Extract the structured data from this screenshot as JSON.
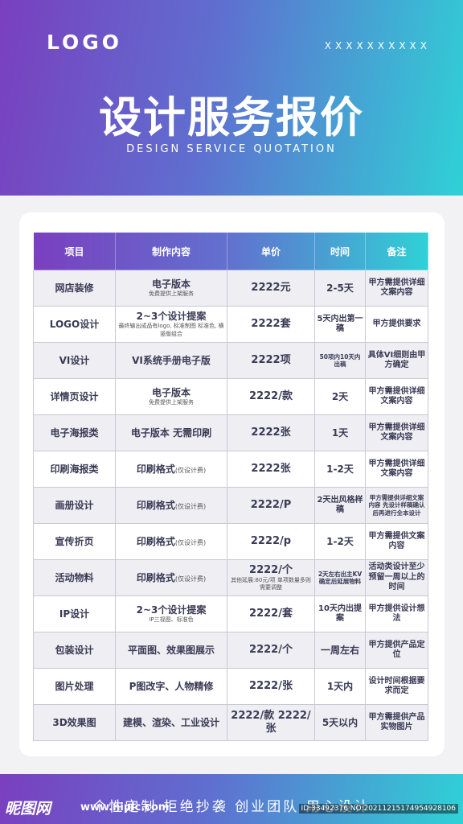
{
  "header": {
    "logo": "LOGO",
    "mark": "XXXXXXXXXX",
    "title": "设计服务报价",
    "subtitle": "DESIGN SERVICE QUOTATION"
  },
  "table": {
    "headers": [
      "项目",
      "制作内容",
      "单价",
      "时间",
      "备注"
    ],
    "rows": [
      {
        "item": "网店装修",
        "content": "电子版本",
        "content_note": "免费提供上架服务",
        "price": "2222元",
        "price_note": "",
        "time": "2-5天",
        "remark": "甲方需提供详细文案内容"
      },
      {
        "item": "LOGO设计",
        "content": "2~3个设计提案",
        "content_note": "最终输出成品有logo, 标准制图 标准色, 横竖版组合",
        "price": "2222套",
        "price_note": "",
        "time": "5天内出第一稿",
        "remark": "甲方提供要求"
      },
      {
        "item": "VI设计",
        "content": "VI系统手册电子版",
        "content_note": "",
        "price": "2222项",
        "price_note": "",
        "time": "50项内10天内出稿",
        "remark": "具体VI细则由甲方确定"
      },
      {
        "item": "详情页设计",
        "content": "电子版本",
        "content_note": "免费提供上架服务",
        "price": "2222/款",
        "price_note": "",
        "time": "2天",
        "remark": "甲方需提供详细文案内容"
      },
      {
        "item": "电子海报类",
        "content": "电子版本 无需印刷",
        "content_note": "",
        "price": "2222张",
        "price_note": "",
        "time": "1天",
        "remark": "甲方需提供详细文案内容"
      },
      {
        "item": "印刷海报类",
        "content": "印刷格式",
        "content_note": "(仅设计费)",
        "price": "2222张",
        "price_note": "",
        "time": "1-2天",
        "remark": "甲方需提供详细文案内容"
      },
      {
        "item": "画册设计",
        "content": "印刷格式",
        "content_note": "(仅设计费)",
        "price": "2222/P",
        "price_note": "",
        "time": "2天出风格样稿",
        "remark": "甲方需提供详细文案内容 先设计样稿确认后再进行全本设计"
      },
      {
        "item": "宣传折页",
        "content": "印刷格式",
        "content_note": "(仅设计费)",
        "price": "2222/p",
        "price_note": "",
        "time": "1-2天",
        "remark": "甲方需提供文案内容"
      },
      {
        "item": "活动物料",
        "content": "印刷格式",
        "content_note": "(仅设计费)",
        "price": "2222/个",
        "price_note": "其他延展:80元/项 单项数量多则需要调整",
        "time": "2天左右出主KV确定后延展物料",
        "remark": "活动类设计至少预留一周以上的时间"
      },
      {
        "item": "IP设计",
        "content": "2~3个设计提案",
        "content_note": "IP三视图、标准色",
        "price": "2222/套",
        "price_note": "",
        "time": "10天内出提案",
        "remark": "甲方提供设计想法"
      },
      {
        "item": "包装设计",
        "content": "平面图、效果图展示",
        "content_note": "",
        "price": "2222/个",
        "price_note": "",
        "time": "一周左右",
        "remark": "甲方提供产品定位"
      },
      {
        "item": "图片处理",
        "content": "P图改字、人物精修",
        "content_note": "",
        "price": "2222/张",
        "price_note": "",
        "time": "1天内",
        "remark": "设计时间根据要求而定"
      },
      {
        "item": "3D效果图",
        "content": "建模、渲染、工业设计",
        "content_note": "",
        "price": "2222/款 2222/张",
        "price_note": "",
        "time": "5天以内",
        "remark": "甲方需提供产品实物图片"
      }
    ]
  },
  "footer": {
    "slogan": "个性定制  拒绝抄袭  创业团队  用心设计",
    "watermark": "昵图网",
    "url": "www.nipic.com",
    "id_text": "ID:33492376 NO:20211215174954928106"
  }
}
